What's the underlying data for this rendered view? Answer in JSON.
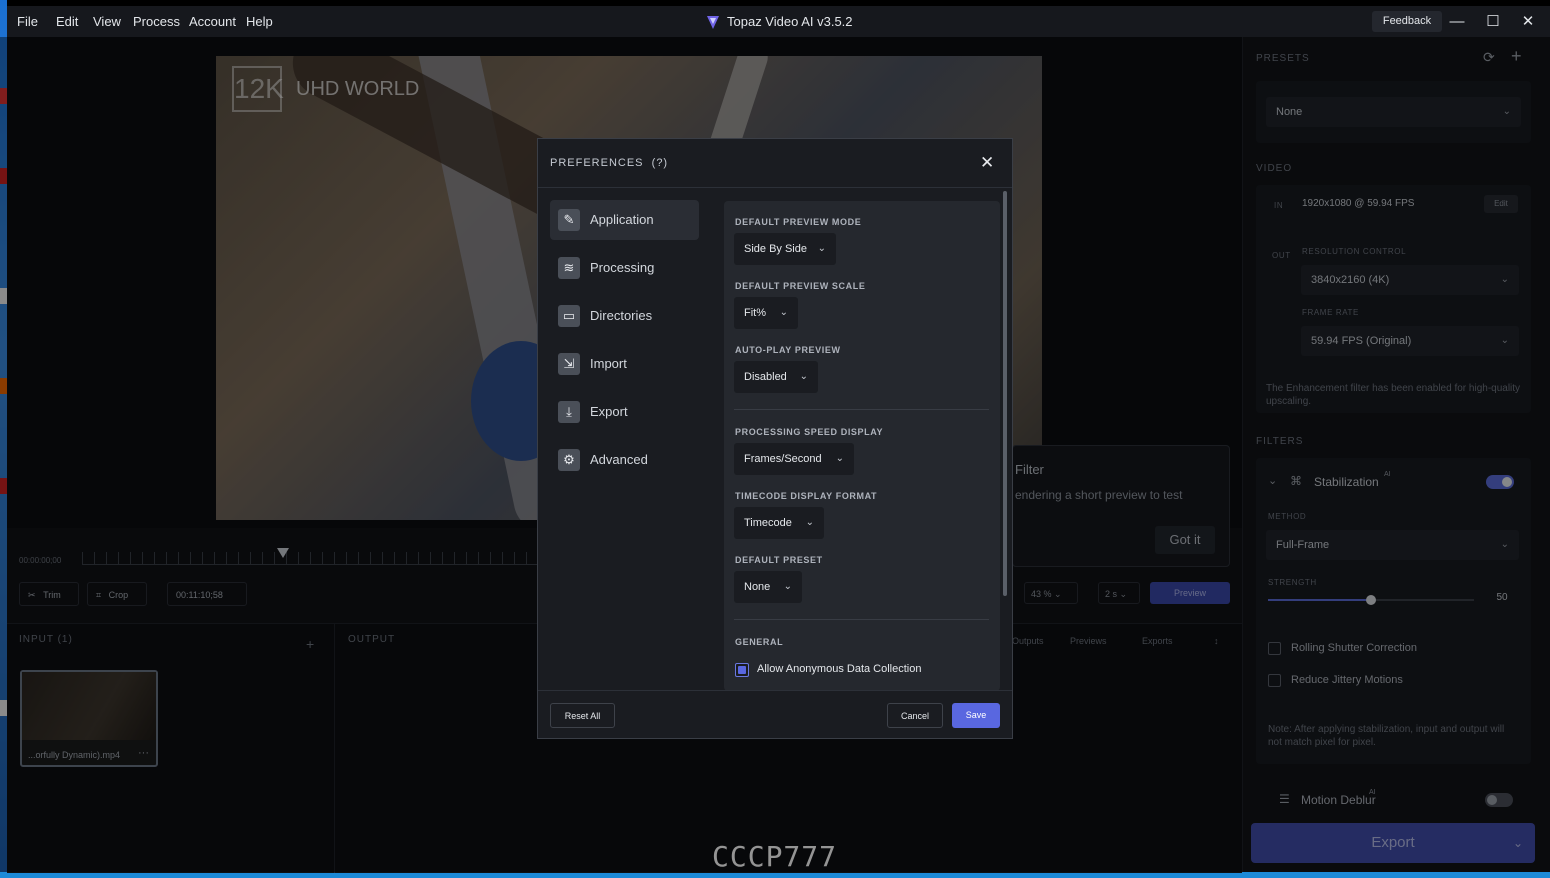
{
  "titlebar": {
    "menu": [
      "File",
      "Edit",
      "View",
      "Process",
      "Account",
      "Help"
    ],
    "app_title": "Topaz Video AI  v3.5.2",
    "feedback_label": "Feedback"
  },
  "video": {
    "logo_text": "12K",
    "brand_text": "UHD WORLD"
  },
  "timeline": {
    "start_time": "00:00:00;00",
    "trim_label": "Trim",
    "crop_label": "Crop",
    "duration": "00:11:10;58"
  },
  "panes": {
    "input_title": "INPUT (1)",
    "add_icon": "+",
    "output_title": "OUTPUT",
    "file_name": "...orfully Dynamic).mp4",
    "more_icon": "···"
  },
  "tooltip": {
    "title": "Filter",
    "text": "endering a short preview to test",
    "button": "Got it"
  },
  "preview_controls": {
    "zoom": "43 %",
    "frames": "2 s",
    "preview_label": "Preview",
    "tabs": [
      "Outputs",
      "Previews",
      "Exports"
    ]
  },
  "watermark": "CCCP777",
  "right_panel": {
    "presets_head": "PRESETS",
    "preset_value": "None",
    "video_head": "VIDEO",
    "in_tag": "IN",
    "input_res": "1920x1080 @ 59.94 FPS",
    "edit_label": "Edit",
    "out_tag": "OUT",
    "resolution_control_label": "RESOLUTION CONTROL",
    "resolution_value": "3840x2160 (4K)",
    "frame_rate_label": "FRAME RATE",
    "frame_rate_value": "59.94 FPS (Original)",
    "enhancement_note": "The Enhancement filter has been enabled for high-quality upscaling.",
    "filters_head": "FILTERS",
    "stabilization_label": "Stabilization",
    "ai_sup": "AI",
    "method_label": "METHOD",
    "method_value": "Full-Frame",
    "strength_label": "STRENGTH",
    "strength_value": "50",
    "strength_fraction": 0.5,
    "rolling_shutter_label": "Rolling Shutter Correction",
    "jittery_label": "Reduce Jittery Motions",
    "stab_note": "Note: After applying stabilization, input and output will not match pixel for pixel.",
    "motion_deblur_label": "Motion Deblur",
    "export_label": "Export"
  },
  "preferences": {
    "title": "PREFERENCES",
    "help": "(?)",
    "close_icon": "✕",
    "nav": [
      {
        "label": "Application",
        "icon": "✎"
      },
      {
        "label": "Processing",
        "icon": "≋"
      },
      {
        "label": "Directories",
        "icon": "▭"
      },
      {
        "label": "Import",
        "icon": "⇲"
      },
      {
        "label": "Export",
        "icon": "⤓"
      },
      {
        "label": "Advanced",
        "icon": "⚙"
      }
    ],
    "default_preview_mode_label": "DEFAULT PREVIEW MODE",
    "default_preview_mode": "Side By Side",
    "default_preview_scale_label": "DEFAULT PREVIEW SCALE",
    "default_preview_scale": "Fit%",
    "auto_play_label": "AUTO-PLAY PREVIEW",
    "auto_play": "Disabled",
    "speed_display_label": "PROCESSING SPEED DISPLAY",
    "speed_display": "Frames/Second",
    "timecode_format_label": "TIMECODE DISPLAY FORMAT",
    "timecode_format": "Timecode",
    "default_preset_label": "DEFAULT PRESET",
    "default_preset": "None",
    "general_label": "GENERAL",
    "anon_data_label": "Allow Anonymous Data Collection",
    "reset_label": "Reset All",
    "cancel_label": "Cancel",
    "save_label": "Save"
  },
  "colors": {
    "accent": "#5967e0",
    "toggle_on": "#5a6bd8"
  }
}
